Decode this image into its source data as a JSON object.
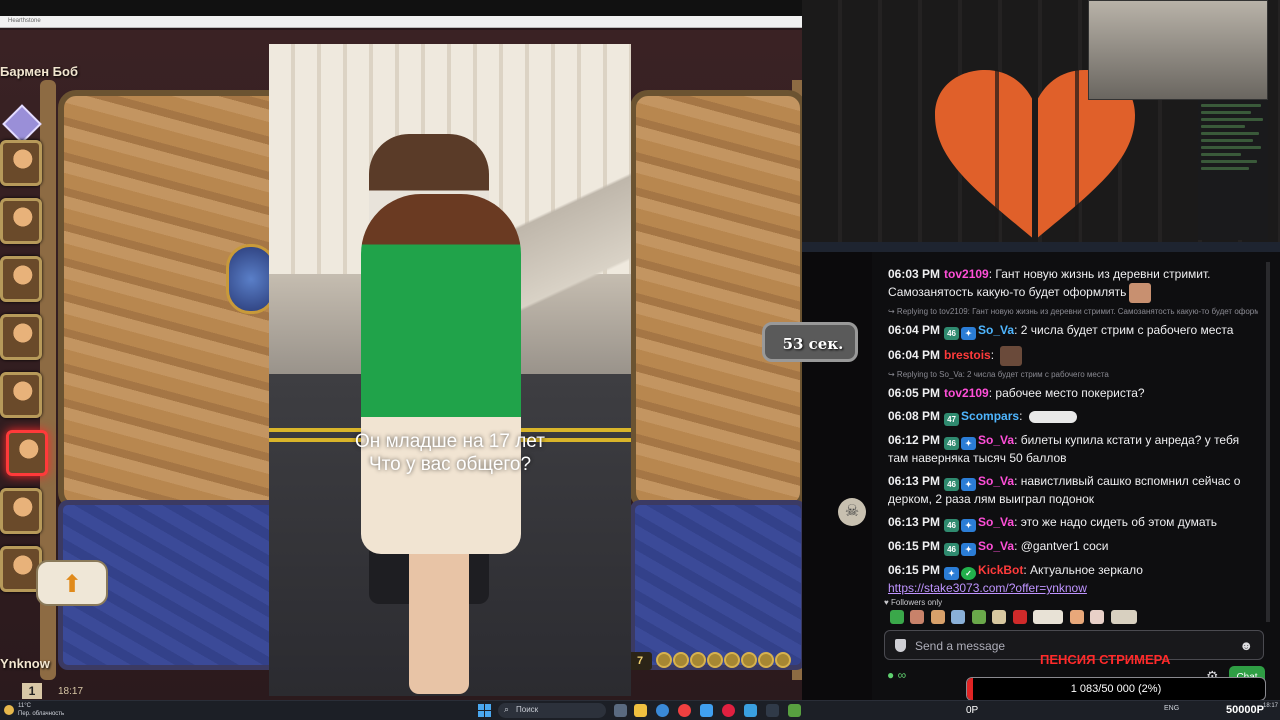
{
  "game": {
    "window_title": "Hearthstone",
    "hero_name": "Бармен Боб",
    "player_name": "Ynknow",
    "player_level": "1",
    "clock": "18:17",
    "timer": "53 сек.",
    "gold_count": "7",
    "hero_armor": "2"
  },
  "video": {
    "caption_line1": "Он младше на 17 лет",
    "caption_line2": "Что у вас общего?"
  },
  "chat": {
    "messages": [
      {
        "time": "06:03 PM",
        "user": "tov2109",
        "color": "#ff4fd8",
        "badges": [],
        "text": "Гант новую жизнь из деревни стримит. Самозанятость какую-то будет оформлять",
        "emote": true
      },
      {
        "reply": "Replying to tov2109: Гант новую жизнь из деревни стримит. Самозанятость какую-то будет оформлять"
      },
      {
        "time": "06:04 PM",
        "user": "So_Va",
        "color": "#4fb6ff",
        "badges": [
          "46",
          "vip"
        ],
        "text": "2 числа будет стрим с рабочего места",
        "emote": false
      },
      {
        "time": "06:04 PM",
        "user": "brestois",
        "color": "#ff3b3b",
        "badges": [],
        "text": "",
        "emote": true
      },
      {
        "reply": "Replying to So_Va: 2 числа будет стрим с рабочего места"
      },
      {
        "time": "06:05 PM",
        "user": "tov2109",
        "color": "#ff4fd8",
        "badges": [],
        "text": "рабочее место покериста?",
        "emote": false
      },
      {
        "time": "06:08 PM",
        "user": "Scompars",
        "color": "#4fb6ff",
        "badges": [
          "47"
        ],
        "text": "",
        "emote": true
      },
      {
        "time": "06:12 PM",
        "user": "So_Va",
        "color": "#ff4fd8",
        "badges": [
          "46",
          "vip"
        ],
        "text": "билеты купила кстати у анреда? у тебя там наверняка тысяч 50 баллов",
        "emote": false
      },
      {
        "time": "06:13 PM",
        "user": "So_Va",
        "color": "#ff4fd8",
        "badges": [
          "46",
          "vip"
        ],
        "text": "навистливый сашко вспомнил сейчас о дерком, 2 раза лям выиграл подонок",
        "emote": false
      },
      {
        "time": "06:13 PM",
        "user": "So_Va",
        "color": "#ff4fd8",
        "badges": [
          "46",
          "vip"
        ],
        "text": "это же надо сидеть об этом думать",
        "emote": false
      },
      {
        "time": "06:15 PM",
        "user": "So_Va",
        "color": "#ff4fd8",
        "badges": [
          "46",
          "vip"
        ],
        "text": "@gantver1 соси",
        "emote": false
      },
      {
        "time": "06:15 PM",
        "user": "KickBot",
        "color": "#ff3b3b",
        "badges": [
          "vip",
          "mod"
        ],
        "text": "Актуальное зеркало",
        "link": "https://stake3073.com/?offer=ynknow",
        "emote": false
      }
    ],
    "followers_only": "Followers only",
    "input_placeholder": "Send a message",
    "chat_button": "Chat",
    "points": "∞",
    "pension_title": "ПЕНСИЯ СТРИМЕРА",
    "goal_text": "1 083/50 000 (2%)",
    "goal_fraction": 0.02,
    "op_text": "0Р",
    "big_counter": "50000Р"
  },
  "taskbar": {
    "weather_temp": "11°C",
    "weather_desc": "Пер. облачность",
    "search_label": "Поиск",
    "lang": "ENG",
    "time": "18:17"
  },
  "colors": {
    "accent_green": "#2f9e44",
    "goal_red": "#e02424",
    "chat_bg": "#0e0e10"
  }
}
